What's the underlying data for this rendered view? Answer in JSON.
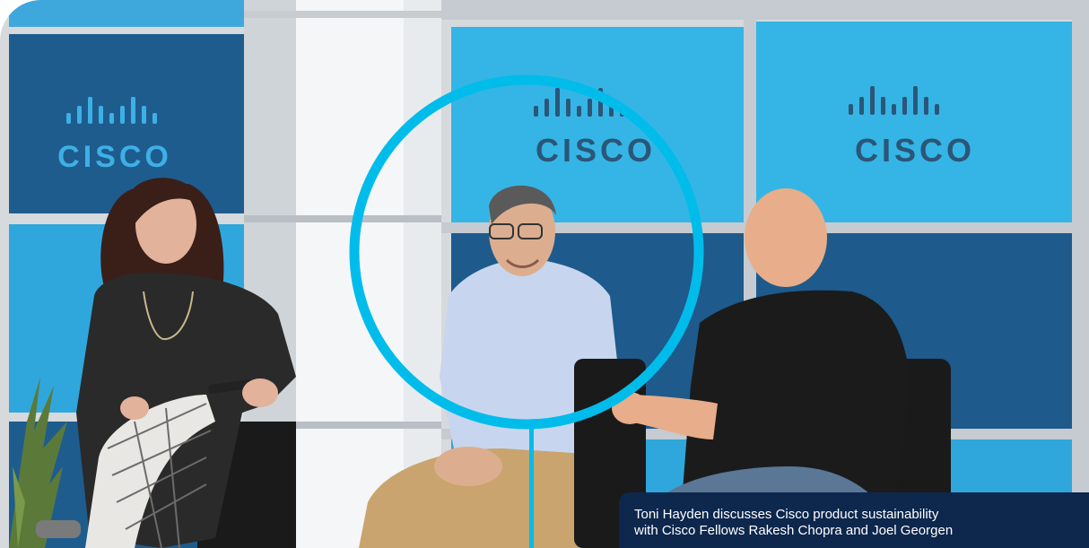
{
  "brand": {
    "logo_text": "CISCO",
    "accent_color": "#00bceb",
    "panel_light": "#2fb2e0",
    "panel_dark": "#1e5a8c",
    "logo_color": "#2b5678"
  },
  "caption": {
    "line1": "Toni Hayden discusses Cisco product sustainability",
    "line2": "with Cisco Fellows Rakesh Chopra and Joel Georgen",
    "background": "#0d274d"
  }
}
